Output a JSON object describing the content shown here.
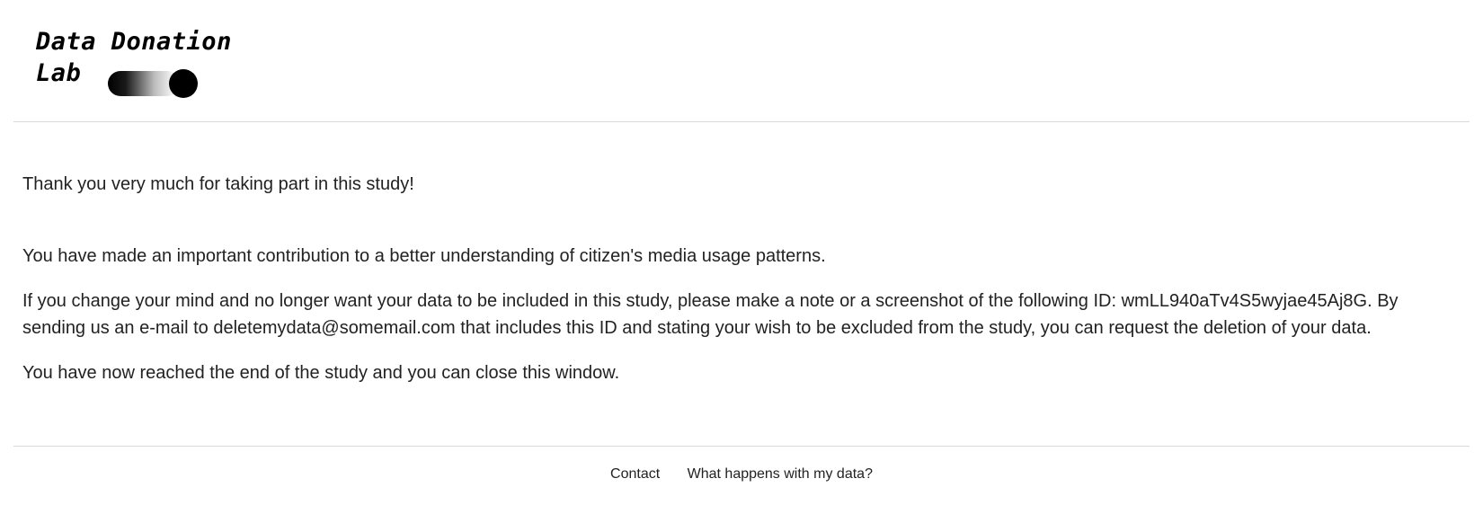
{
  "header": {
    "logo": {
      "line1": "Data Donation",
      "line2": "Lab"
    }
  },
  "content": {
    "thanks": "Thank you very much for taking part in this study!",
    "contribution": "You have made an important contribution to a better understanding of citizen's media usage patterns.",
    "change_mind": "If you change your mind and no longer want your data to be included in this study, please make a note or a screenshot of the following ID: wmLL940aTv4S5wyjae45Aj8G. By sending us an e-mail to deletemydata@somemail.com that includes this ID and stating your wish to be excluded from the study, you can request the deletion of your data.",
    "end": "You have now reached the end of the study and you can close this window."
  },
  "footer": {
    "links": [
      {
        "label": "Contact"
      },
      {
        "label": "What happens with my data?"
      }
    ]
  },
  "colors": {
    "text": "#222222",
    "divider": "#d9d9d9",
    "logo": "#000000"
  }
}
